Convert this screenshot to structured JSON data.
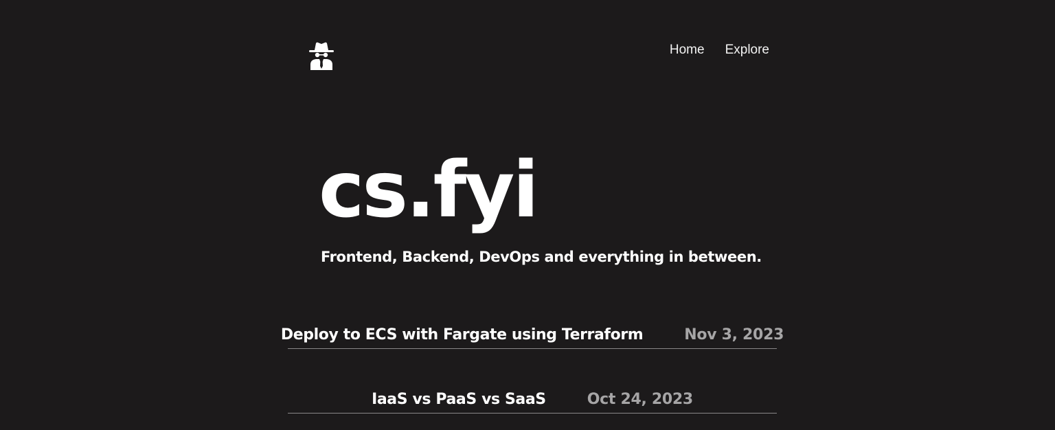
{
  "header": {
    "logo_icon": "spy-incognito-icon",
    "nav": {
      "home_label": "Home",
      "explore_label": "Explore"
    }
  },
  "hero": {
    "title": "cs.fyi",
    "tagline": "Frontend, Backend, DevOps and everything in between."
  },
  "posts": [
    {
      "title": "Deploy to ECS with Fargate using Terraform",
      "date": "Nov 3, 2023"
    },
    {
      "title": "IaaS vs PaaS vs SaaS",
      "date": "Oct 24, 2023"
    }
  ],
  "colors": {
    "background": "#1c1a1b",
    "text": "#ffffff",
    "date_text": "#a6a5a6",
    "divider": "#8a8889"
  }
}
